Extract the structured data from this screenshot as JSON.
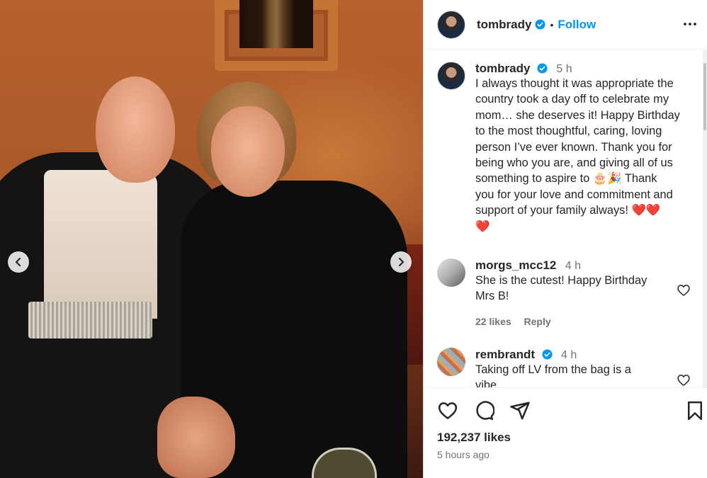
{
  "post": {
    "author": "tombrady",
    "follow_label": "Follow",
    "separator": "•",
    "caption": {
      "time": "5 h",
      "lines": [
        "I always thought it was appropriate the",
        "country took a day off to celebrate my",
        "mom… she deserves it! Happy Birthday",
        "to the most thoughtful, caring, loving",
        "person I’ve ever known. Thank you for",
        "being who you are, and giving all of us",
        "something to aspire to 🎂🎉 Thank",
        "you for your love and commitment and",
        "support of your family always! ❤️❤️",
        "❤️"
      ]
    },
    "comments": [
      {
        "user": "morgs_mcc12",
        "time": "4 h",
        "lines": [
          "She is the cutest! Happy Birthday",
          "Mrs B!"
        ],
        "likes": "22 likes",
        "reply": "Reply"
      },
      {
        "user": "rembrandt",
        "time": "4 h",
        "verified": true,
        "lines": [
          "Taking off LV from the bag is a",
          "vibe"
        ]
      }
    ],
    "like_count": "192,237 likes",
    "posted_ago": "5 hours ago"
  },
  "icons": {
    "carousel_prev": "chevron-left-icon",
    "carousel_next": "chevron-right-icon",
    "verified": "verified-badge-icon",
    "more": "more-options-icon",
    "like": "heart-icon",
    "comment": "comment-icon",
    "share": "share-icon",
    "save": "bookmark-icon"
  },
  "colors": {
    "accent": "#0095f6",
    "text": "#262626",
    "muted": "#737373",
    "verified": "#0095f6"
  }
}
